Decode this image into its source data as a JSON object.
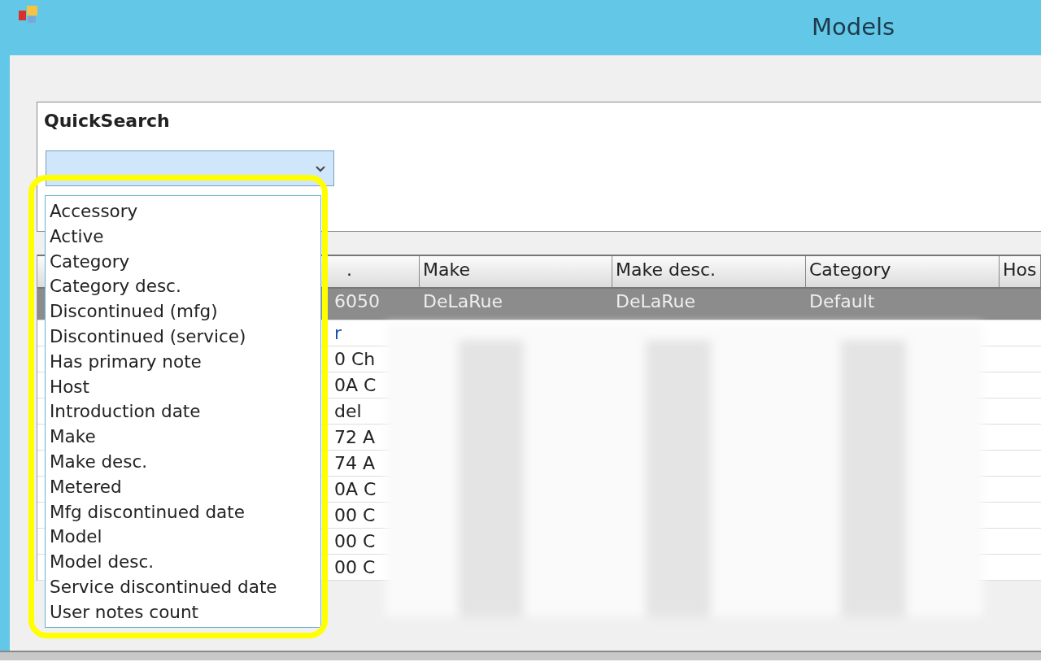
{
  "window": {
    "title": "Models"
  },
  "quick_search": {
    "label": "QuickSearch",
    "expanded": true,
    "options": [
      "Accessory",
      "Active",
      "Category",
      "Category desc.",
      "Discontinued (mfg)",
      "Discontinued (service)",
      "Has primary note",
      "Host",
      "Introduction date",
      "Make",
      "Make desc.",
      "Metered",
      "Mfg discontinued date",
      "Model",
      "Model desc.",
      "Service discontinued date",
      "User notes count"
    ]
  },
  "table": {
    "columns": [
      ".",
      "Make",
      "Make desc.",
      "Category",
      "Hos"
    ],
    "rows": [
      {
        "selected": true,
        "cells": [
          "6050",
          "DeLaRue",
          "DeLaRue",
          "Default"
        ]
      },
      {
        "selected": false,
        "cells": [
          "r"
        ]
      },
      {
        "selected": false,
        "cells": [
          "0 Ch"
        ]
      },
      {
        "selected": false,
        "cells": [
          "0A C"
        ]
      },
      {
        "selected": false,
        "cells": [
          "del"
        ]
      },
      {
        "selected": false,
        "cells": [
          "72 A"
        ]
      },
      {
        "selected": false,
        "cells": [
          "74 A"
        ]
      },
      {
        "selected": false,
        "cells": [
          "0A C"
        ]
      },
      {
        "selected": false,
        "cells": [
          "00 C"
        ]
      },
      {
        "selected": false,
        "cells": [
          "00 C"
        ]
      },
      {
        "selected": false,
        "cells": [
          "00 C"
        ]
      }
    ]
  }
}
